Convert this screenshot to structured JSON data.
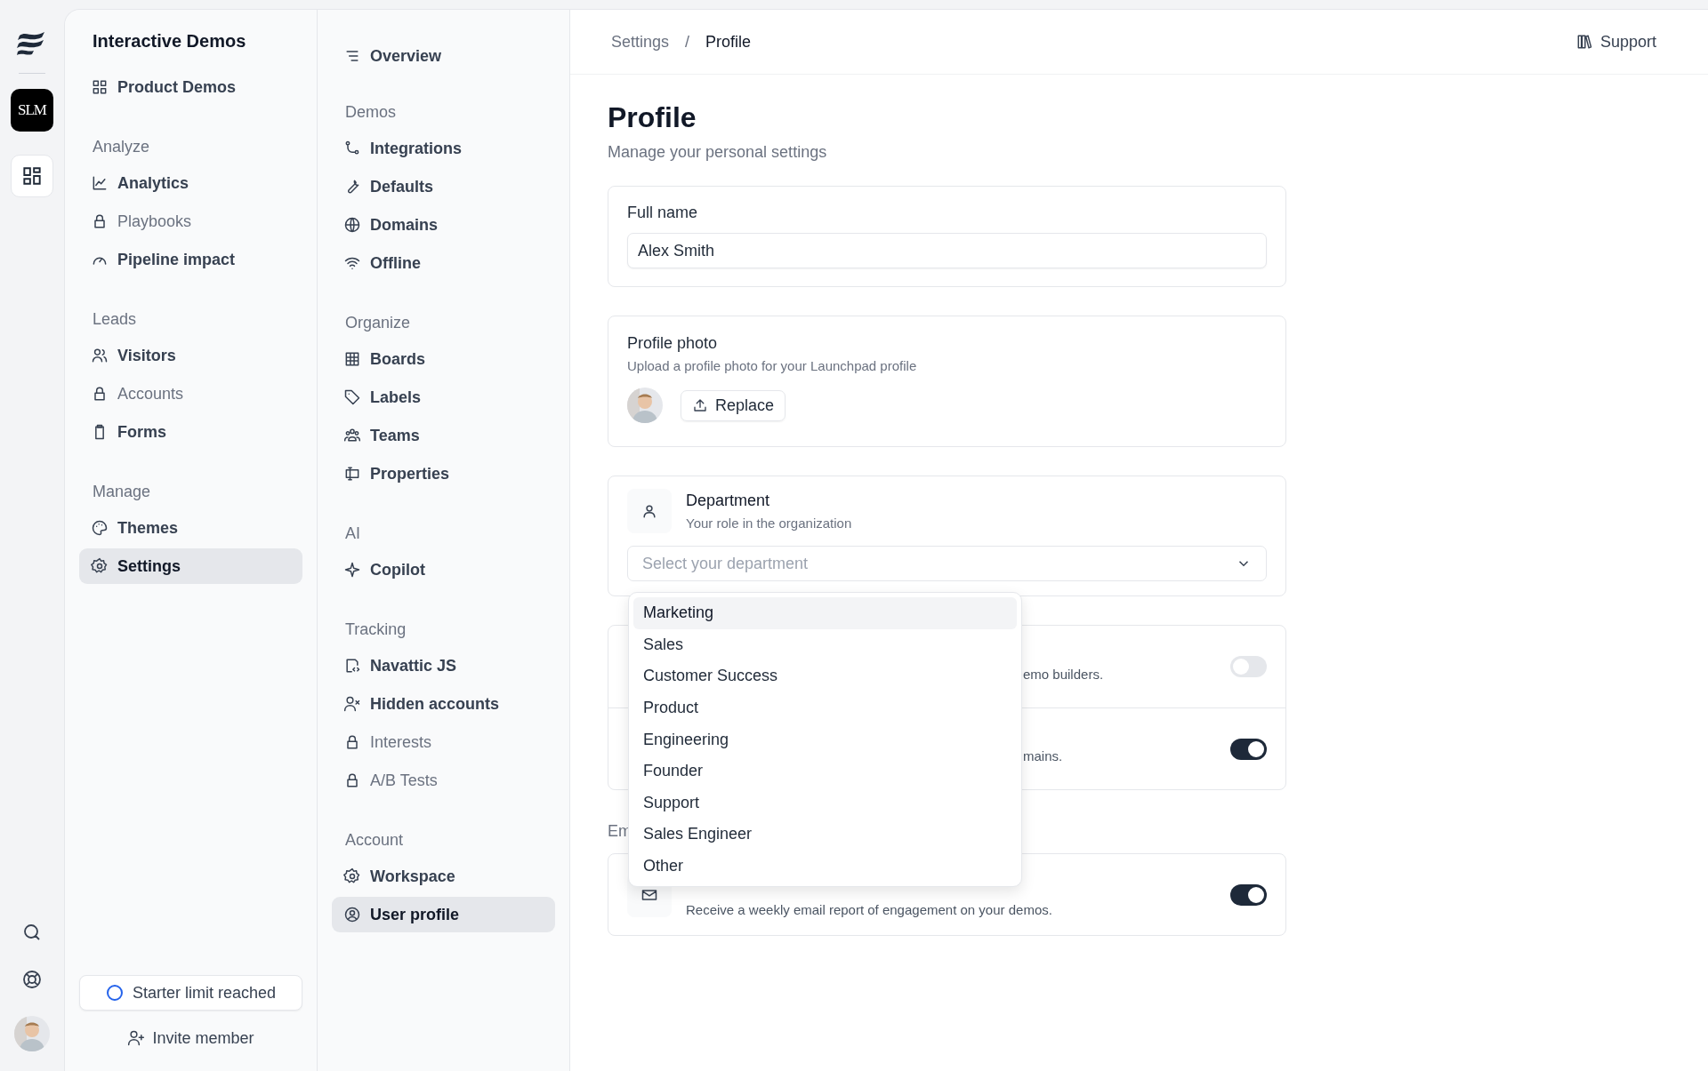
{
  "rail": {
    "workspace_badge": "SLM"
  },
  "sidebar": {
    "title": "Interactive Demos",
    "top_items": [
      {
        "label": "Product Demos",
        "selected": false,
        "locked": false
      }
    ],
    "sections": [
      {
        "heading": "Analyze",
        "items": [
          {
            "label": "Analytics",
            "selected": false,
            "locked": false
          },
          {
            "label": "Playbooks",
            "selected": false,
            "locked": true
          },
          {
            "label": "Pipeline impact",
            "selected": false,
            "locked": false
          }
        ]
      },
      {
        "heading": "Leads",
        "items": [
          {
            "label": "Visitors",
            "selected": false,
            "locked": false
          },
          {
            "label": "Accounts",
            "selected": false,
            "locked": true
          },
          {
            "label": "Forms",
            "selected": false,
            "locked": false
          }
        ]
      },
      {
        "heading": "Manage",
        "items": [
          {
            "label": "Themes",
            "selected": false,
            "locked": false
          },
          {
            "label": "Settings",
            "selected": true,
            "locked": false
          }
        ]
      }
    ],
    "limit_button": "Starter limit reached",
    "invite_button": "Invite member"
  },
  "settings_nav": {
    "top_items": [
      {
        "label": "Overview",
        "selected": false,
        "locked": false
      }
    ],
    "sections": [
      {
        "heading": "Demos",
        "items": [
          {
            "label": "Integrations",
            "selected": false,
            "locked": false
          },
          {
            "label": "Defaults",
            "selected": false,
            "locked": false
          },
          {
            "label": "Domains",
            "selected": false,
            "locked": false
          },
          {
            "label": "Offline",
            "selected": false,
            "locked": false
          }
        ]
      },
      {
        "heading": "Organize",
        "items": [
          {
            "label": "Boards",
            "selected": false,
            "locked": false
          },
          {
            "label": "Labels",
            "selected": false,
            "locked": false
          },
          {
            "label": "Teams",
            "selected": false,
            "locked": false
          },
          {
            "label": "Properties",
            "selected": false,
            "locked": false
          }
        ]
      },
      {
        "heading": "AI",
        "items": [
          {
            "label": "Copilot",
            "selected": false,
            "locked": false
          }
        ]
      },
      {
        "heading": "Tracking",
        "items": [
          {
            "label": "Navattic JS",
            "selected": false,
            "locked": false
          },
          {
            "label": "Hidden accounts",
            "selected": false,
            "locked": false
          },
          {
            "label": "Interests",
            "selected": false,
            "locked": true
          },
          {
            "label": "A/B Tests",
            "selected": false,
            "locked": true
          }
        ]
      },
      {
        "heading": "Account",
        "items": [
          {
            "label": "Workspace",
            "selected": false,
            "locked": false
          },
          {
            "label": "User profile",
            "selected": true,
            "locked": false
          }
        ]
      }
    ]
  },
  "header": {
    "breadcrumb": [
      "Settings",
      "/",
      "Profile"
    ],
    "support": "Support"
  },
  "page": {
    "title": "Profile",
    "subtitle": "Manage your personal settings",
    "full_name": {
      "label": "Full name",
      "value": "Alex Smith"
    },
    "photo": {
      "title": "Profile photo",
      "description": "Upload a profile photo for your Launchpad profile",
      "button": "Replace"
    },
    "department": {
      "title": "Department",
      "description": "Your role in the organization",
      "placeholder": "Select your department"
    },
    "dropdown": [
      {
        "label": "Marketing",
        "highlighted": true
      },
      {
        "label": "Sales",
        "highlighted": false
      },
      {
        "label": "Customer Success",
        "highlighted": false
      },
      {
        "label": "Product",
        "highlighted": false
      },
      {
        "label": "Engineering",
        "highlighted": false
      },
      {
        "label": "Founder",
        "highlighted": false
      },
      {
        "label": "Support",
        "highlighted": false
      },
      {
        "label": "Sales Engineer",
        "highlighted": false
      },
      {
        "label": "Other",
        "highlighted": false
      }
    ],
    "toggles": [
      {
        "fragment": "emo builders.",
        "on": false
      },
      {
        "fragment": "mains.",
        "on": true
      }
    ],
    "email_heading_fragment": "Em",
    "weekly": {
      "description": "Receive a weekly email report of engagement on your demos.",
      "on": true
    }
  }
}
